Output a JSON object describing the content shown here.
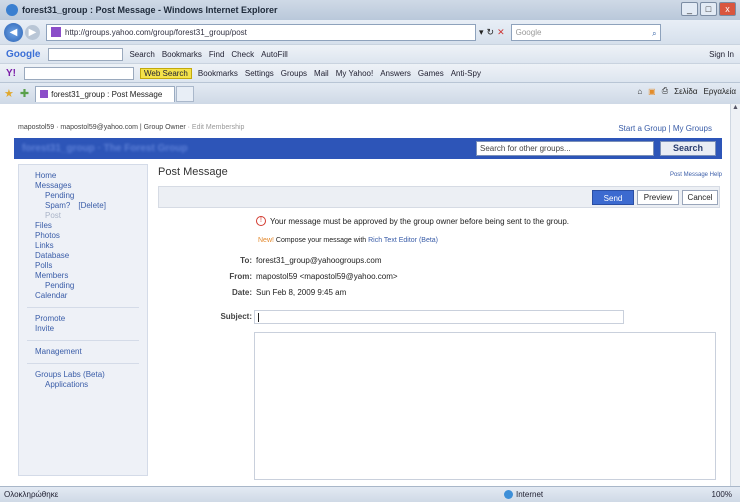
{
  "window": {
    "title": "forest31_group : Post Message - Windows Internet Explorer",
    "controls": [
      "_",
      "□",
      "x"
    ]
  },
  "address_bar": {
    "url": "http://groups.yahoo.com/group/forest31_group/post",
    "search_placeholder": "Google"
  },
  "google_toolbar": {
    "logo": "Google",
    "search_label": "Search",
    "items": [
      "Bookmarks",
      "Find",
      "Check",
      "AutoFill"
    ],
    "right": "Sign In"
  },
  "yahoo_toolbar": {
    "logo": "Y!",
    "web_search": "Web Search",
    "items": [
      "Bookmarks",
      "Settings",
      "Groups",
      "Mail",
      "My Yahoo!",
      "Answers",
      "Games",
      "Anti-Spy"
    ]
  },
  "tab_bar": {
    "tab_title": "forest31_group : Post Message",
    "commands": [
      "Σελίδα",
      "Εργαλεία"
    ]
  },
  "page": {
    "top_left": "mapostol59 · mapostol59@yahoo.com",
    "top_sep": " | ",
    "group_owner": "Group Owner",
    "edit_membership": " · Edit Membership",
    "start_group": "Start a Group | My Groups",
    "group_title": "forest31_group · The Forest Group",
    "search_input": "Search for other groups...",
    "search_button": "Search"
  },
  "sidebar": {
    "home": "Home",
    "messages": "Messages",
    "pending": "Pending",
    "spam": "Spam?",
    "delete": "[Delete]",
    "post": "Post",
    "files": "Files",
    "photos": "Photos",
    "links": "Links",
    "database": "Database",
    "polls": "Polls",
    "members": "Members",
    "members_pending": "Pending",
    "calendar": "Calendar",
    "promote": "Promote",
    "invite": "Invite",
    "management": "Management",
    "groups_labs": "Groups Labs (Beta)",
    "applications": "Applications"
  },
  "main": {
    "title": "Post Message",
    "help": "Post Message Help",
    "send": "Send",
    "preview": "Preview",
    "cancel": "Cancel",
    "notice": "Your message must be approved by the group owner before being sent to the group.",
    "new_label": "New!",
    "compose_text": " Compose your message with ",
    "rte_link": "Rich Text Editor (Beta)",
    "to_label": "To:",
    "to_value": "forest31_group@yahoogroups.com",
    "from_label": "From:",
    "from_value": "mapostol59 <mapostol59@yahoo.com>",
    "date_label": "Date:",
    "date_value": "Sun Feb 8, 2009 9:45 am",
    "subject_label": "Subject:"
  },
  "status_bar": {
    "left": "Ολοκληρώθηκε",
    "zone": "Internet",
    "zoom": "100%"
  }
}
